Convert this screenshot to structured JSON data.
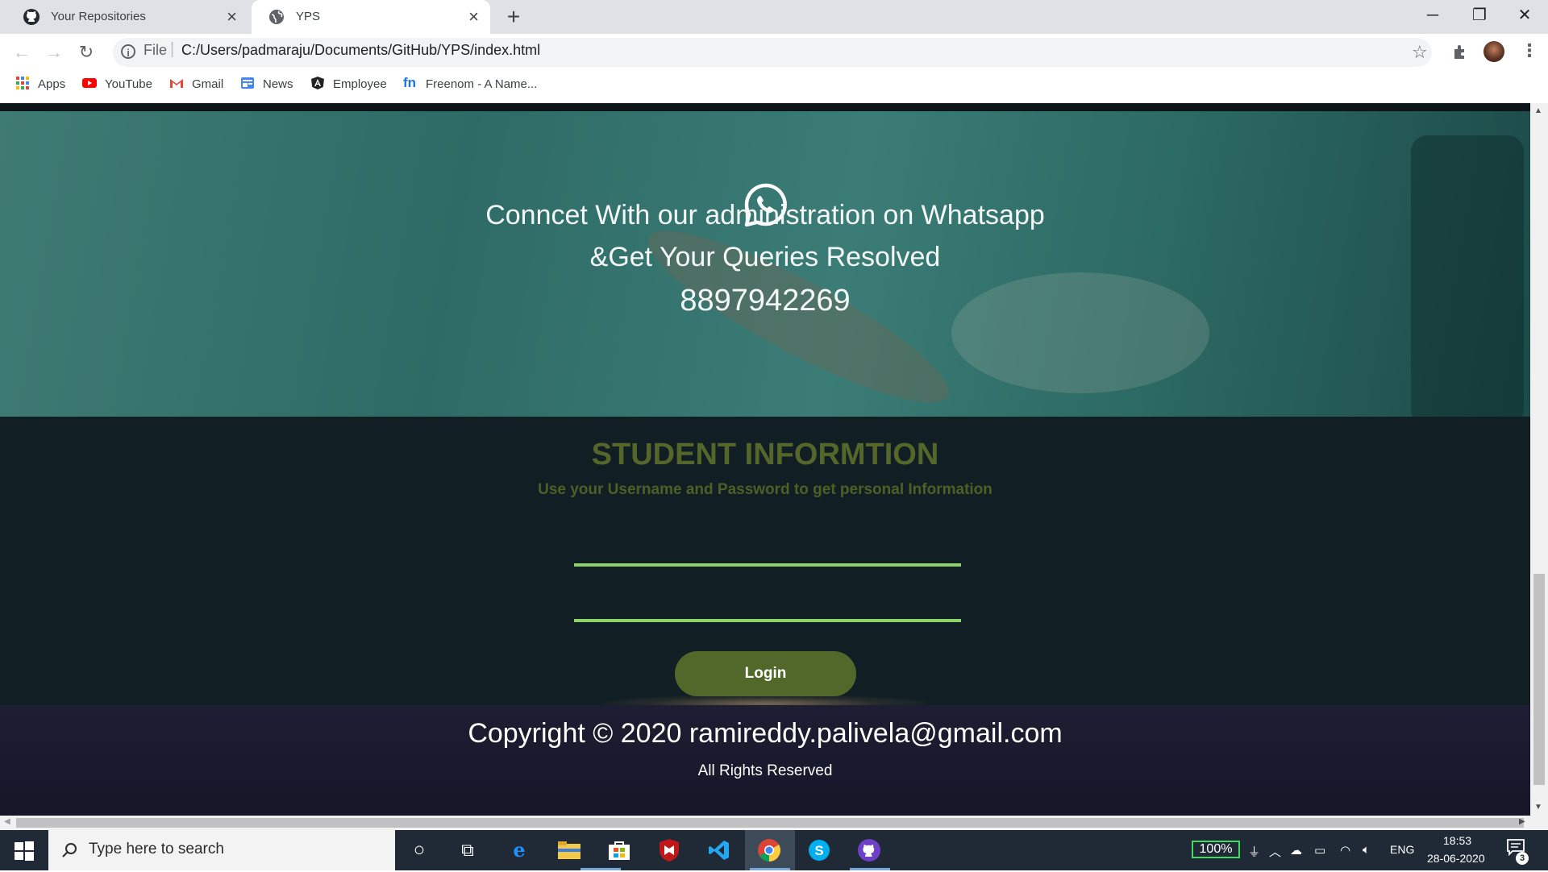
{
  "browser": {
    "tabs": [
      {
        "title": "Your Repositories",
        "favicon": "github-icon",
        "active": false
      },
      {
        "title": "YPS",
        "favicon": "globe-icon",
        "active": true
      }
    ],
    "new_tab": "+",
    "window_controls": {
      "minimize": "─",
      "restore": "❐",
      "close": "✕"
    },
    "nav": {
      "back": "←",
      "forward": "→",
      "reload": "↻"
    },
    "address": {
      "scheme_label": "File",
      "url": "C:/Users/padmaraju/Documents/GitHub/YPS/index.html"
    },
    "bookmarks": [
      {
        "label": "Apps",
        "icon": "apps-grid-icon"
      },
      {
        "label": "YouTube",
        "icon": "youtube-icon"
      },
      {
        "label": "Gmail",
        "icon": "gmail-icon"
      },
      {
        "label": "News",
        "icon": "news-icon"
      },
      {
        "label": "Employee",
        "icon": "angular-icon"
      },
      {
        "label": "Freenom - A Name...",
        "icon": "freenom-icon"
      }
    ]
  },
  "hero": {
    "line1": "Conncet With our administration on Whatsapp",
    "line2": "&Get Your Queries Resolved",
    "phone": "8897942269"
  },
  "student": {
    "title": "STUDENT INFORMTION",
    "subtitle": "Use your Username and Password to get personal Information",
    "username_value": "",
    "password_value": "",
    "login_label": "Login"
  },
  "footer": {
    "copyright": "Copyright © 2020 ramireddy.palivela@gmail.com",
    "rights": "All Rights Reserved"
  },
  "taskbar": {
    "search_placeholder": "Type here to search",
    "battery": "100%",
    "language": "ENG",
    "time": "18:53",
    "date": "28-06-2020",
    "notifications": "3"
  },
  "colors": {
    "accent_green": "#52682b",
    "field_underline": "#8ed46a",
    "hero_teal": "#3e7b73"
  }
}
